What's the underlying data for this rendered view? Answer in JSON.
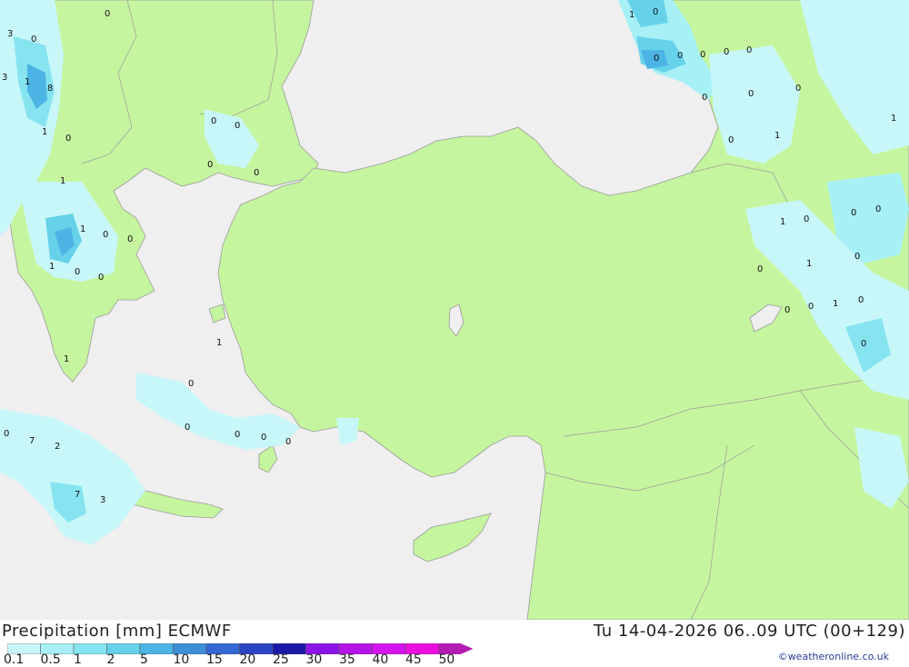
{
  "title": "Precipitation [mm] ECMWF",
  "valid_time": "Tu 14-04-2026 06..09 UTC (00+129)",
  "credit": "©weatheronline.co.uk",
  "legend": {
    "ticks": [
      "0.1",
      "0.5",
      "1",
      "2",
      "5",
      "10",
      "15",
      "20",
      "25",
      "30",
      "35",
      "40",
      "45",
      "50"
    ],
    "colors": [
      "#c8f7fa",
      "#a6f0f6",
      "#86e4f0",
      "#66d2ea",
      "#4cb4e4",
      "#3f8ed8",
      "#3468d2",
      "#2a44c4",
      "#1a1aa6",
      "#8b14e6",
      "#b414e6",
      "#d414ec",
      "#ec10de",
      "#b21cb2"
    ]
  },
  "colors": {
    "land": "#c6f5a0",
    "sea": "#efefef",
    "border": "#9a9a9a"
  },
  "map_labels": [
    "0",
    "3",
    "0",
    "3",
    "1",
    "8",
    "1",
    "0",
    "1",
    "1",
    "0",
    "0",
    "1",
    "0",
    "0",
    "0",
    "0",
    "0",
    "0",
    "1",
    "0",
    "1",
    "0",
    "0",
    "0",
    "0",
    "0",
    "7",
    "2",
    "7",
    "3",
    "1",
    "0",
    "0",
    "0",
    "0",
    "0",
    "0",
    "0",
    "0",
    "0",
    "0",
    "1",
    "1",
    "1",
    "0",
    "0",
    "0",
    "1",
    "0",
    "0",
    "0",
    "0",
    "1",
    "0",
    "0"
  ]
}
